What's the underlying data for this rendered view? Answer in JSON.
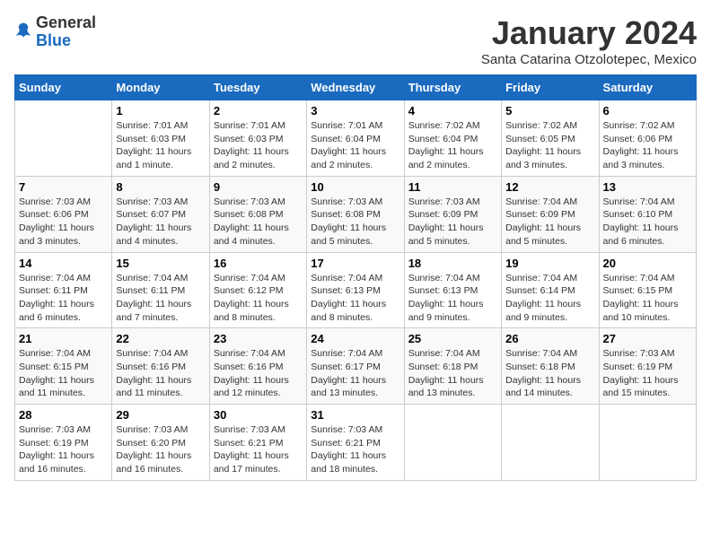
{
  "header": {
    "logo": {
      "general": "General",
      "blue": "Blue"
    },
    "title": "January 2024",
    "location": "Santa Catarina Otzolotepec, Mexico"
  },
  "weekdays": [
    "Sunday",
    "Monday",
    "Tuesday",
    "Wednesday",
    "Thursday",
    "Friday",
    "Saturday"
  ],
  "weeks": [
    [
      {
        "day": null,
        "info": null
      },
      {
        "day": "1",
        "sunrise": "7:01 AM",
        "sunset": "6:03 PM",
        "daylight": "11 hours and 1 minute."
      },
      {
        "day": "2",
        "sunrise": "7:01 AM",
        "sunset": "6:03 PM",
        "daylight": "11 hours and 2 minutes."
      },
      {
        "day": "3",
        "sunrise": "7:01 AM",
        "sunset": "6:04 PM",
        "daylight": "11 hours and 2 minutes."
      },
      {
        "day": "4",
        "sunrise": "7:02 AM",
        "sunset": "6:04 PM",
        "daylight": "11 hours and 2 minutes."
      },
      {
        "day": "5",
        "sunrise": "7:02 AM",
        "sunset": "6:05 PM",
        "daylight": "11 hours and 3 minutes."
      },
      {
        "day": "6",
        "sunrise": "7:02 AM",
        "sunset": "6:06 PM",
        "daylight": "11 hours and 3 minutes."
      }
    ],
    [
      {
        "day": "7",
        "sunrise": "7:03 AM",
        "sunset": "6:06 PM",
        "daylight": "11 hours and 3 minutes."
      },
      {
        "day": "8",
        "sunrise": "7:03 AM",
        "sunset": "6:07 PM",
        "daylight": "11 hours and 4 minutes."
      },
      {
        "day": "9",
        "sunrise": "7:03 AM",
        "sunset": "6:08 PM",
        "daylight": "11 hours and 4 minutes."
      },
      {
        "day": "10",
        "sunrise": "7:03 AM",
        "sunset": "6:08 PM",
        "daylight": "11 hours and 5 minutes."
      },
      {
        "day": "11",
        "sunrise": "7:03 AM",
        "sunset": "6:09 PM",
        "daylight": "11 hours and 5 minutes."
      },
      {
        "day": "12",
        "sunrise": "7:04 AM",
        "sunset": "6:09 PM",
        "daylight": "11 hours and 5 minutes."
      },
      {
        "day": "13",
        "sunrise": "7:04 AM",
        "sunset": "6:10 PM",
        "daylight": "11 hours and 6 minutes."
      }
    ],
    [
      {
        "day": "14",
        "sunrise": "7:04 AM",
        "sunset": "6:11 PM",
        "daylight": "11 hours and 6 minutes."
      },
      {
        "day": "15",
        "sunrise": "7:04 AM",
        "sunset": "6:11 PM",
        "daylight": "11 hours and 7 minutes."
      },
      {
        "day": "16",
        "sunrise": "7:04 AM",
        "sunset": "6:12 PM",
        "daylight": "11 hours and 8 minutes."
      },
      {
        "day": "17",
        "sunrise": "7:04 AM",
        "sunset": "6:13 PM",
        "daylight": "11 hours and 8 minutes."
      },
      {
        "day": "18",
        "sunrise": "7:04 AM",
        "sunset": "6:13 PM",
        "daylight": "11 hours and 9 minutes."
      },
      {
        "day": "19",
        "sunrise": "7:04 AM",
        "sunset": "6:14 PM",
        "daylight": "11 hours and 9 minutes."
      },
      {
        "day": "20",
        "sunrise": "7:04 AM",
        "sunset": "6:15 PM",
        "daylight": "11 hours and 10 minutes."
      }
    ],
    [
      {
        "day": "21",
        "sunrise": "7:04 AM",
        "sunset": "6:15 PM",
        "daylight": "11 hours and 11 minutes."
      },
      {
        "day": "22",
        "sunrise": "7:04 AM",
        "sunset": "6:16 PM",
        "daylight": "11 hours and 11 minutes."
      },
      {
        "day": "23",
        "sunrise": "7:04 AM",
        "sunset": "6:16 PM",
        "daylight": "11 hours and 12 minutes."
      },
      {
        "day": "24",
        "sunrise": "7:04 AM",
        "sunset": "6:17 PM",
        "daylight": "11 hours and 13 minutes."
      },
      {
        "day": "25",
        "sunrise": "7:04 AM",
        "sunset": "6:18 PM",
        "daylight": "11 hours and 13 minutes."
      },
      {
        "day": "26",
        "sunrise": "7:04 AM",
        "sunset": "6:18 PM",
        "daylight": "11 hours and 14 minutes."
      },
      {
        "day": "27",
        "sunrise": "7:03 AM",
        "sunset": "6:19 PM",
        "daylight": "11 hours and 15 minutes."
      }
    ],
    [
      {
        "day": "28",
        "sunrise": "7:03 AM",
        "sunset": "6:19 PM",
        "daylight": "11 hours and 16 minutes."
      },
      {
        "day": "29",
        "sunrise": "7:03 AM",
        "sunset": "6:20 PM",
        "daylight": "11 hours and 16 minutes."
      },
      {
        "day": "30",
        "sunrise": "7:03 AM",
        "sunset": "6:21 PM",
        "daylight": "11 hours and 17 minutes."
      },
      {
        "day": "31",
        "sunrise": "7:03 AM",
        "sunset": "6:21 PM",
        "daylight": "11 hours and 18 minutes."
      },
      {
        "day": null,
        "info": null
      },
      {
        "day": null,
        "info": null
      },
      {
        "day": null,
        "info": null
      }
    ]
  ],
  "labels": {
    "sunrise": "Sunrise:",
    "sunset": "Sunset:",
    "daylight": "Daylight:"
  }
}
